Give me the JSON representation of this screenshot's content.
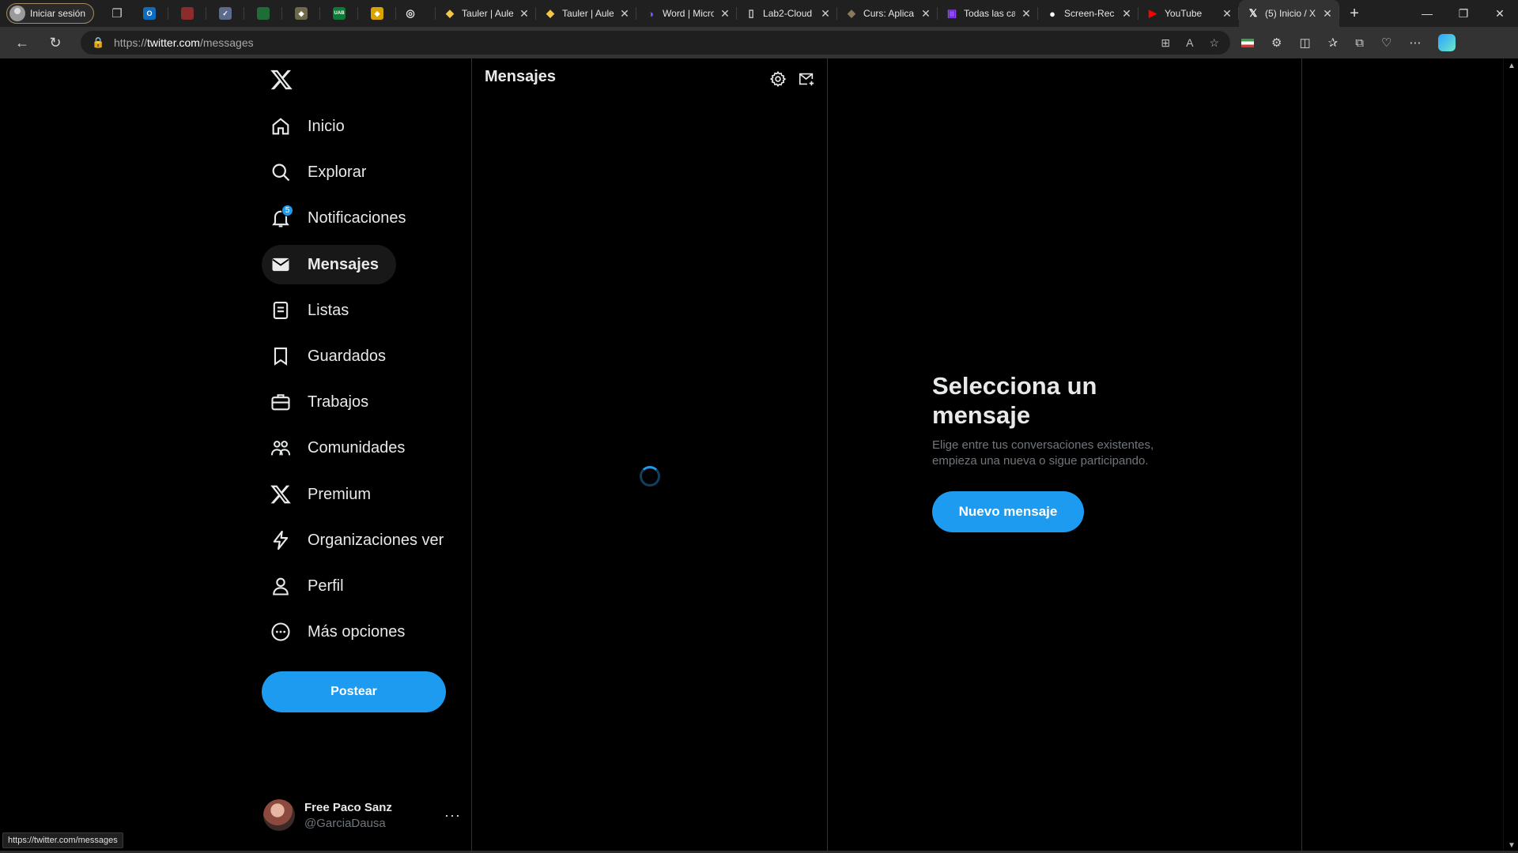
{
  "browser": {
    "profile_label": "Iniciar sesión",
    "pinned_tabs": [
      {
        "name": "outlook",
        "color": "#0f6cbd",
        "glyph": "O"
      },
      {
        "name": "app-red",
        "color": "#8b2b2b",
        "glyph": ""
      },
      {
        "name": "app-round",
        "color": "#5a6b8c",
        "glyph": "✓"
      },
      {
        "name": "app-green",
        "color": "#1f6b3a",
        "glyph": ""
      },
      {
        "name": "app-diamond",
        "color": "#6d6a4b",
        "glyph": "◆"
      },
      {
        "name": "app-uab",
        "color": "#0f7a38",
        "glyph": "UAB"
      },
      {
        "name": "app-yellow",
        "color": "#d9a300",
        "glyph": "◆"
      }
    ],
    "tabs": [
      {
        "title": "",
        "icon_color": "#e6e6e6",
        "glyph": "◎"
      },
      {
        "title": "Tauler | Aule",
        "icon_color": "#f2c744",
        "glyph": "◆"
      },
      {
        "title": "Tauler | Aule",
        "icon_color": "#f2c744",
        "glyph": "◆"
      },
      {
        "title": "Word | Micro",
        "icon_color": "#7a5af5",
        "glyph": "◑"
      },
      {
        "title": "Lab2-Cloud",
        "icon_color": "#d0d0d0",
        "glyph": "▯"
      },
      {
        "title": "Curs: Aplica",
        "icon_color": "#8a7a5a",
        "glyph": "◆"
      },
      {
        "title": "Todas las ca",
        "icon_color": "#9146ff",
        "glyph": "▣"
      },
      {
        "title": "Screen-Rec",
        "icon_color": "#ffffff",
        "glyph": "●"
      },
      {
        "title": "YouTube",
        "icon_color": "#ff0000",
        "glyph": "▶"
      },
      {
        "title": "(5) Inicio / X",
        "icon_color": "#ffffff",
        "glyph": "𝕏"
      }
    ],
    "url_prefix": "https://",
    "url_host": "twitter.com",
    "url_path": "/messages",
    "status_url": "https://twitter.com/messages"
  },
  "sidebar": {
    "items": [
      {
        "label": "Inicio",
        "icon": "home-icon"
      },
      {
        "label": "Explorar",
        "icon": "search-icon"
      },
      {
        "label": "Notificaciones",
        "icon": "bell-icon",
        "badge": "5"
      },
      {
        "label": "Mensajes",
        "icon": "mail-icon",
        "active": true
      },
      {
        "label": "Listas",
        "icon": "list-icon"
      },
      {
        "label": "Guardados",
        "icon": "bookmark-icon"
      },
      {
        "label": "Trabajos",
        "icon": "briefcase-icon"
      },
      {
        "label": "Comunidades",
        "icon": "communities-icon"
      },
      {
        "label": "Premium",
        "icon": "x-logo-icon"
      },
      {
        "label": "Organizaciones ver",
        "icon": "lightning-icon"
      },
      {
        "label": "Perfil",
        "icon": "person-icon"
      },
      {
        "label": "Más opciones",
        "icon": "more-circle-icon"
      }
    ],
    "post_label": "Postear",
    "account": {
      "name": "Free Paco Sanz",
      "handle": "@GarciaDausa"
    }
  },
  "messages": {
    "title": "Mensajes"
  },
  "detail": {
    "title": "Selecciona un mensaje",
    "subtitle": "Elige entre tus conversaciones existentes, empieza una nueva o sigue participando.",
    "button_label": "Nuevo mensaje"
  },
  "colors": {
    "accent": "#1d9bf0",
    "text": "#e7e9ea",
    "muted": "#71767b",
    "border": "#2f3336"
  }
}
